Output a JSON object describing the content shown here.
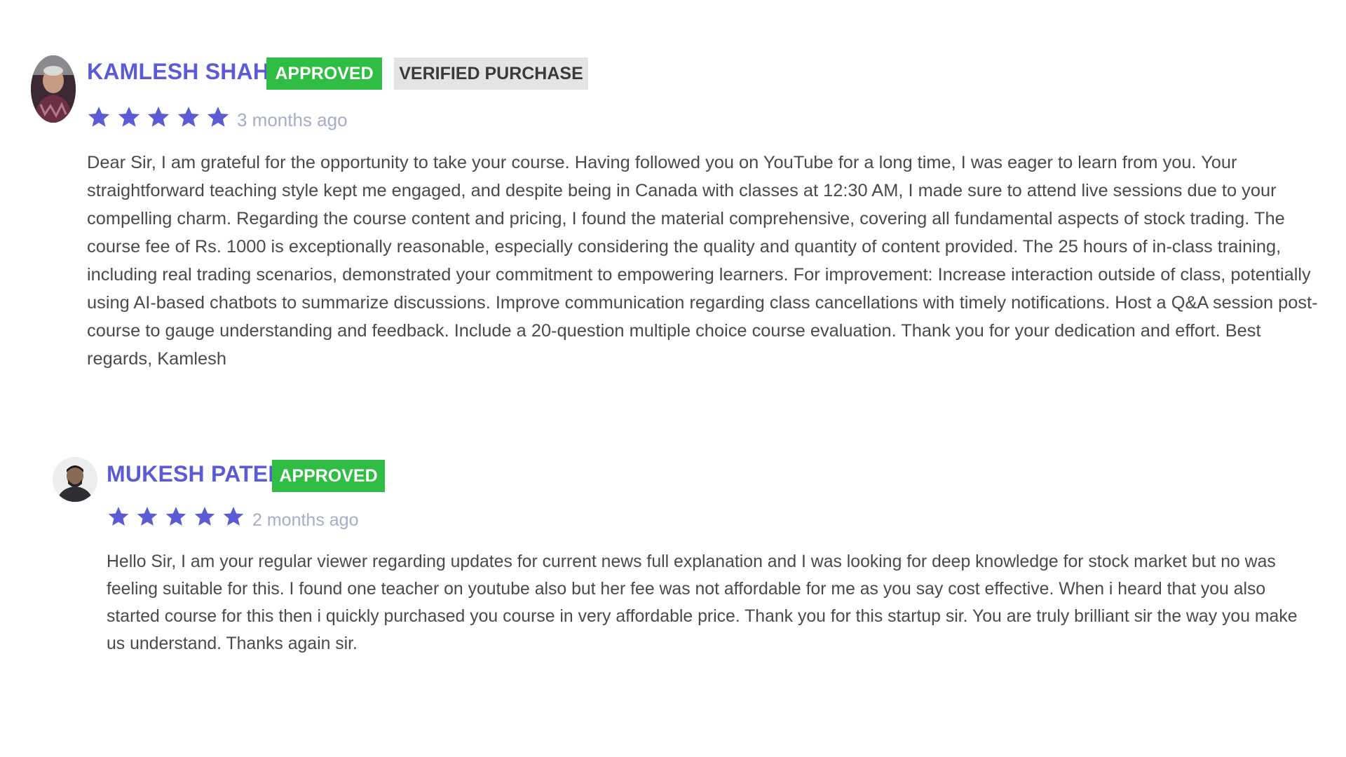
{
  "colors": {
    "accent": "#5b5bd6",
    "approved": "#2fbd43",
    "verified_bg": "#e4e4e4",
    "time_text": "#a7adc6",
    "body_text": "#4a4a4a"
  },
  "reviews": [
    {
      "name": "KAMLESH SHAH",
      "badges": [
        "APPROVED",
        "VERIFIED PURCHASE"
      ],
      "rating": 5,
      "time": "3 months ago",
      "avatar_icon": "user-avatar",
      "text": "Dear Sir, I am grateful for the opportunity to take your course. Having followed you on YouTube for a long time, I was eager to learn from you. Your straightforward teaching style kept me engaged, and despite being in Canada with classes at 12:30 AM, I made sure to attend live sessions due to your compelling charm. Regarding the course content and pricing, I found the material comprehensive, covering all fundamental aspects of stock trading. The course fee of Rs. 1000 is exceptionally reasonable, especially considering the quality and quantity of content provided. The 25 hours of in-class training, including real trading scenarios, demonstrated your commitment to empowering learners. For improvement: Increase interaction outside of class, potentially using AI-based chatbots to summarize discussions. Improve communication regarding class cancellations with timely notifications. Host a Q&A session post-course to gauge understanding and feedback. Include a 20-question multiple choice course evaluation. Thank you for your dedication and effort. Best regards, Kamlesh"
    },
    {
      "name": "MUKESH PATEL",
      "badges": [
        "APPROVED"
      ],
      "rating": 5,
      "time": "2 months ago",
      "avatar_icon": "user-avatar",
      "text": "Hello Sir, I am your regular viewer regarding updates for current news full explanation and I was looking for deep knowledge for stock market but no was feeling suitable for this. I found one teacher on youtube also but her fee was not affordable for me as you say cost effective. When i heard that you also started course for this then i quickly purchased you course in very affordable price. Thank you for this startup sir. You are truly brilliant sir the way you make us understand. Thanks again sir."
    }
  ]
}
